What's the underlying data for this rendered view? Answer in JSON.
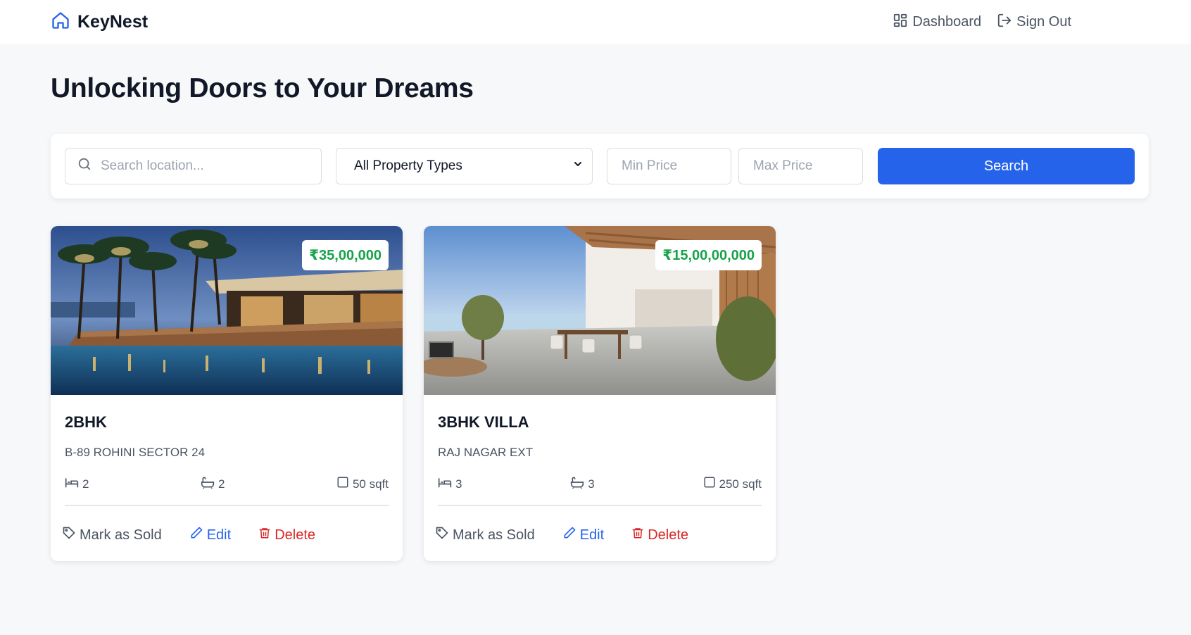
{
  "header": {
    "brand": "KeyNest",
    "nav": [
      {
        "label": "Dashboard",
        "icon": "dashboard-icon"
      },
      {
        "label": "Sign Out",
        "icon": "sign-out-icon"
      }
    ]
  },
  "page_title": "Unlocking Doors to Your Dreams",
  "search": {
    "location_placeholder": "Search location...",
    "property_type_selected": "All Property Types",
    "min_price_placeholder": "Min Price",
    "max_price_placeholder": "Max Price",
    "button_label": "Search"
  },
  "listings": [
    {
      "price": "₹35,00,000",
      "title": "2BHK",
      "address": "B-89 ROHINI SECTOR 24",
      "beds": "2",
      "baths": "2",
      "area": "50 sqft",
      "image": "resort-pool-at-night-photo"
    },
    {
      "price": "₹15,00,00,000",
      "title": "3BHK VILLA",
      "address": "RAJ NAGAR EXT",
      "beds": "3",
      "baths": "3",
      "area": "250 sqft",
      "image": "villa-dining-room-sea-view-photo"
    }
  ],
  "card_actions": {
    "mark_sold": "Mark as Sold",
    "edit": "Edit",
    "delete": "Delete"
  },
  "colors": {
    "accent": "#2563eb",
    "price": "#16a34a",
    "danger": "#dc2626",
    "background": "#f7f8fa"
  }
}
